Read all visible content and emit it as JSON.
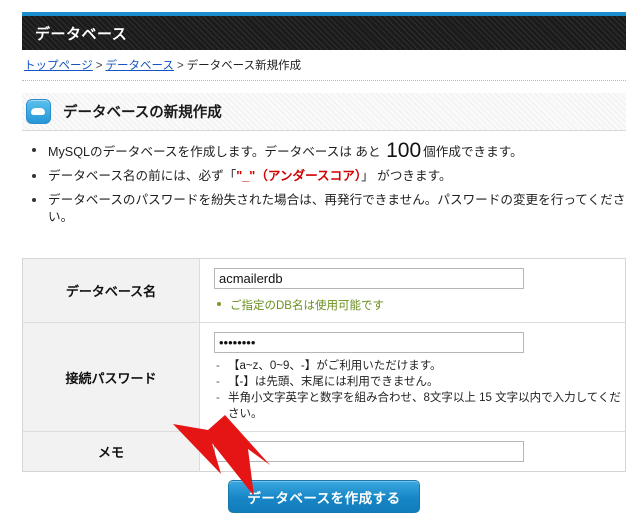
{
  "window": {
    "title": "データベース"
  },
  "breadcrumb": {
    "items": [
      {
        "label": "トップページ",
        "link": true
      },
      {
        "label": "データベース",
        "link": true
      },
      {
        "label": "データベース新規作成",
        "link": false
      }
    ],
    "separator": ">"
  },
  "section": {
    "icon": "database-icon",
    "title": "データベースの新規作成"
  },
  "notes": {
    "item1_pre": "MySQLのデータベースを作成します。データベースは あと ",
    "item1_count": "100",
    "item1_post": "個作成できます。",
    "item2_pre": "データベース名の前には、必ず「",
    "item2_em": "\"_\"（アンダースコア）",
    "item2_post": "」 がつきます。",
    "item3": "データベースのパスワードを紛失された場合は、再発行できません。パスワードの変更を行ってください。"
  },
  "form": {
    "rows": {
      "dbname": {
        "label": "データベース名",
        "value": "acmailerdb",
        "placeholder": "",
        "status": "ご指定のDB名は使用可能です"
      },
      "password": {
        "label": "接続パスワード",
        "value": "••••••••",
        "placeholder": "",
        "hints": [
          "【a~z、0~9、-】がご利用いただけます。",
          "【-】は先頭、末尾には利用できません。",
          "半角小文字英字と数字を組み合わせ、8文字以上 15 文字以内で入力してください。"
        ]
      },
      "memo": {
        "label": "メモ",
        "value": "",
        "placeholder": ""
      }
    },
    "submit_label": "データベースを作成する"
  },
  "colors": {
    "accent_blue": "#1c8ecd",
    "titlebar_bg": "#1b1b1b",
    "link_blue": "#1355c4",
    "warn_red": "#d00000",
    "ok_green": "#6a8e1e",
    "button_blue": "#1786c6",
    "arrow_red": "#e51515"
  }
}
